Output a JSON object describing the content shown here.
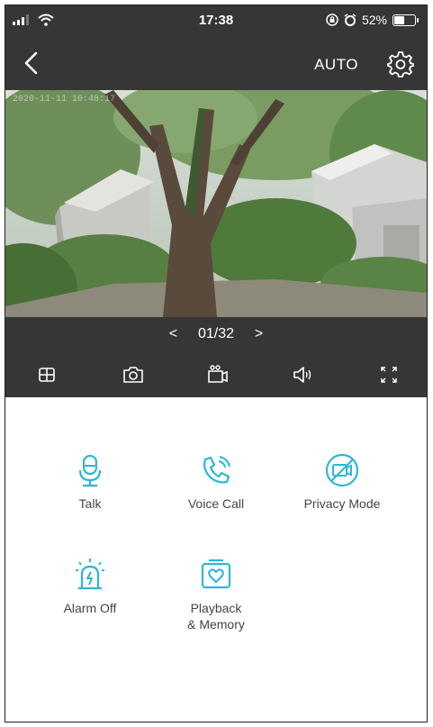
{
  "status_bar": {
    "time": "17:38",
    "battery": "52%",
    "battery_level": 0.52
  },
  "nav": {
    "auto_label": "AUTO"
  },
  "video": {
    "overlay_text": "2020-11-11 10:48:17"
  },
  "pager": {
    "prev": "<",
    "label": "01/32",
    "next": ">"
  },
  "toolbar": {
    "icons": [
      "layout-grid-icon",
      "snapshot-camera-icon",
      "record-video-icon",
      "speaker-icon",
      "fullscreen-icon"
    ]
  },
  "actions": [
    {
      "label": "Talk",
      "icon": "microphone-icon"
    },
    {
      "label": "Voice Call",
      "icon": "phone-call-icon"
    },
    {
      "label": "Privacy Mode",
      "icon": "privacy-camera-off-icon"
    },
    {
      "label": "Alarm Off",
      "icon": "alarm-siren-icon"
    },
    {
      "label": "Playback\n& Memory",
      "icon": "playback-memory-icon"
    }
  ],
  "colors": {
    "accent": "#2bb8d6",
    "dark_bar": "#363636",
    "text": "#444444"
  }
}
